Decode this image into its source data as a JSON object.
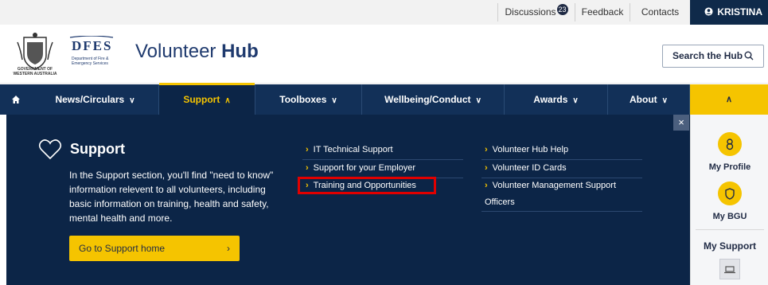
{
  "topbar": {
    "discussions_label": "Discussions",
    "discussions_count": "23",
    "feedback_label": "Feedback",
    "contacts_label": "Contacts",
    "user_label": "KRISTINA",
    "user_icon": "user-circle-icon"
  },
  "header": {
    "crest_text": "GOVERNMENT OF WESTERN AUSTRALIA",
    "dfes_text": "DFES",
    "dfes_sub": "Department of Fire & Emergency Services",
    "title_regular": "Volunteer",
    "title_bold": "Hub",
    "search_label": "Search the Hub",
    "search_icon": "search-icon"
  },
  "nav": {
    "home_icon": "home-icon",
    "items": [
      {
        "label": "News/Circulars",
        "chevron": "∨"
      },
      {
        "label": "Support",
        "chevron": "∧"
      },
      {
        "label": "Toolboxes",
        "chevron": "∨"
      },
      {
        "label": "Wellbeing/Conduct",
        "chevron": "∨"
      },
      {
        "label": "Awards",
        "chevron": "∨"
      },
      {
        "label": "About",
        "chevron": "∨"
      }
    ],
    "rail_toggle_chevron": "∧",
    "active_color": "#f5c400",
    "bar_color": "#123058"
  },
  "panel": {
    "close_label": "×",
    "heart_icon": "heart-outline-icon",
    "title": "Support",
    "description": "In the Support section, you'll find \"need to know\" information relevent to all volunteers, including basic information on training, health and safety, mental health and more.",
    "go_home_label": "Go to Support home",
    "go_home_arrow": "›",
    "arrow": "›",
    "column1": [
      {
        "label": "IT Technical Support"
      },
      {
        "label": "Support for your Employer"
      },
      {
        "label": "Training and Opportunities"
      }
    ],
    "column2": [
      {
        "label": "Volunteer Hub Help"
      },
      {
        "label": "Volunteer ID Cards"
      },
      {
        "label": "Volunteer Management Support"
      },
      {
        "label": "Officers"
      }
    ],
    "highlight_color": "#e00000"
  },
  "rail": {
    "profile_label": "My Profile",
    "profile_icon": "person-icon",
    "bgu_label": "My BGU",
    "bgu_icon": "shield-icon",
    "support_label": "My Support",
    "support_icon": "laptop-icon"
  }
}
